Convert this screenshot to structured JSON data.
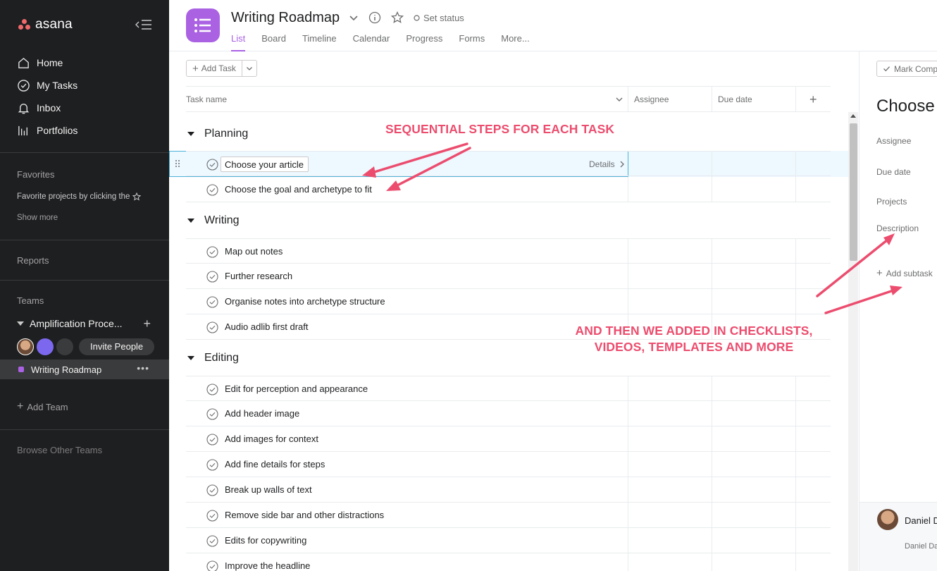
{
  "brand": {
    "name": "asana"
  },
  "sidebar": {
    "nav": [
      {
        "label": "Home",
        "icon": "home-icon"
      },
      {
        "label": "My Tasks",
        "icon": "check-circle-icon"
      },
      {
        "label": "Inbox",
        "icon": "bell-icon"
      },
      {
        "label": "Portfolios",
        "icon": "bar-chart-icon"
      }
    ],
    "favorites_label": "Favorites",
    "favorites_hint": "Favorite projects by clicking the",
    "show_more": "Show more",
    "reports": "Reports",
    "teams_label": "Teams",
    "team_name": "Amplification Proce...",
    "invite_people": "Invite People",
    "project_name": "Writing Roadmap",
    "add_team": "Add Team",
    "browse_teams": "Browse Other Teams"
  },
  "header": {
    "title": "Writing Roadmap",
    "set_status": "Set status",
    "tabs": [
      "List",
      "Board",
      "Timeline",
      "Calendar",
      "Progress",
      "Forms",
      "More..."
    ]
  },
  "toolbar": {
    "add_task": "Add Task"
  },
  "table": {
    "columns": {
      "task_name": "Task name",
      "assignee": "Assignee",
      "due_date": "Due date"
    },
    "details_label": "Details",
    "sections": [
      {
        "name": "Planning",
        "tasks": [
          "Choose your article",
          "Choose the goal and archetype to fit"
        ]
      },
      {
        "name": "Writing",
        "tasks": [
          "Map out notes",
          "Further research",
          "Organise notes into archetype structure",
          "Audio adlib first draft"
        ]
      },
      {
        "name": "Editing",
        "tasks": [
          "Edit for perception and appearance",
          "Add header image",
          "Add images for context",
          "Add fine details for steps",
          "Break up walls of text",
          "Remove side bar and other distractions",
          "Edits for copywriting",
          "Improve the headline"
        ]
      }
    ]
  },
  "pane": {
    "mark_complete": "Mark Comp",
    "title": "Choose",
    "labels": {
      "assignee": "Assignee",
      "due_date": "Due date",
      "projects": "Projects",
      "description": "Description",
      "add_subtask": "Add subtask"
    },
    "footer_name": "Daniel D",
    "footer_sub": "Daniel Da"
  },
  "annotations": {
    "top": "SEQUENTIAL STEPS FOR EACH TASK",
    "bottom_line1": "AND THEN WE ADDED IN CHECKLISTS,",
    "bottom_line2": "VIDEOS, TEMPLATES AND MORE",
    "color": "#ec4d6e"
  },
  "colors": {
    "accent": "#aa62e3",
    "sidebar_bg": "#1e1f21",
    "selection": "#4eb2d8"
  }
}
